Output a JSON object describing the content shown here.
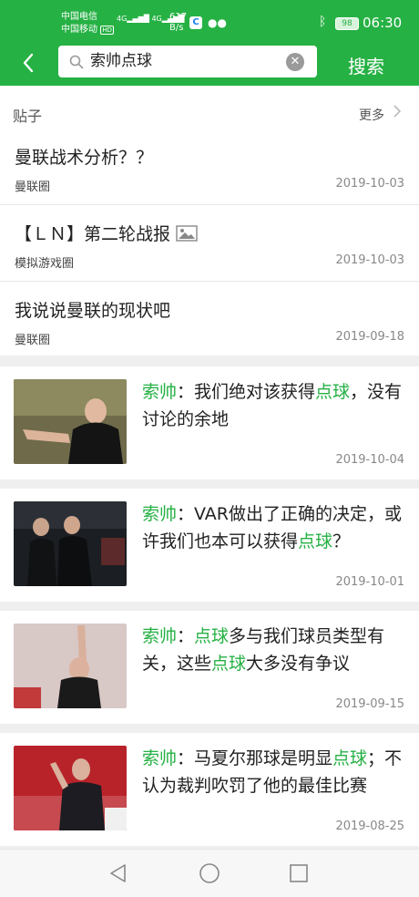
{
  "status_bar": {
    "carrier1": "中国电信",
    "carrier2": "中国移动",
    "hd": "HD",
    "net1": "4G",
    "net2": "4G",
    "speed_value": "617",
    "speed_unit": "B/s",
    "app_badge": "C",
    "battery": "98",
    "time": "06:30"
  },
  "search": {
    "query": "索帅点球",
    "button_label": "搜索"
  },
  "posts": {
    "title": "贴子",
    "more_label": "更多",
    "items": [
      {
        "title": "曼联战术分析？？",
        "group": "曼联圈",
        "date": "2019-10-03",
        "has_image_icon": false
      },
      {
        "title": "【ＬＮ】第二轮战报",
        "group": "模拟游戏圈",
        "date": "2019-10-03",
        "has_image_icon": true
      },
      {
        "title": "我说说曼联的现状吧",
        "group": "曼联圈",
        "date": "2019-09-18",
        "has_image_icon": false
      }
    ]
  },
  "news": [
    {
      "segments": [
        {
          "t": "索帅",
          "h": true
        },
        {
          "t": "：我们绝对该获得",
          "h": false
        },
        {
          "t": "点球",
          "h": true
        },
        {
          "t": "，没有讨论的余地",
          "h": false
        }
      ],
      "date": "2019-10-04"
    },
    {
      "segments": [
        {
          "t": "索帅",
          "h": true
        },
        {
          "t": "：VAR做出了正确的决定，或许我们也本可以获得",
          "h": false
        },
        {
          "t": "点球",
          "h": true
        },
        {
          "t": "？",
          "h": false
        }
      ],
      "date": "2019-10-01"
    },
    {
      "segments": [
        {
          "t": "索帅",
          "h": true
        },
        {
          "t": "：",
          "h": false
        },
        {
          "t": "点球",
          "h": true
        },
        {
          "t": "多与我们球员类型有关，这些",
          "h": false
        },
        {
          "t": "点球",
          "h": true
        },
        {
          "t": "大多没有争议",
          "h": false
        }
      ],
      "date": "2019-09-15"
    },
    {
      "segments": [
        {
          "t": "索帅",
          "h": true
        },
        {
          "t": "：马夏尔那球是明显",
          "h": false
        },
        {
          "t": "点球",
          "h": true
        },
        {
          "t": "；不认为裁判吹罚了他的最佳比赛",
          "h": false
        }
      ],
      "date": "2019-08-25"
    }
  ],
  "colors": {
    "accent": "#26b144"
  },
  "icons": {
    "back": "chevron-left-icon",
    "search": "search-icon",
    "clear": "clear-icon",
    "nav_back": "triangle-back-icon",
    "nav_home": "circle-home-icon",
    "nav_recent": "square-recent-icon"
  }
}
